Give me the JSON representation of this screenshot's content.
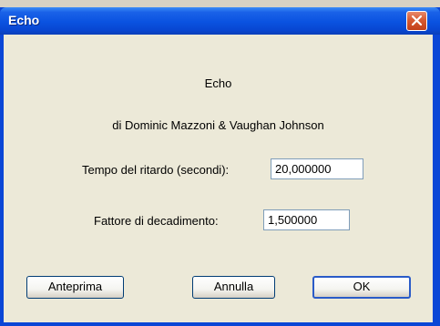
{
  "window": {
    "title": "Echo"
  },
  "header": {
    "plugin_name": "Echo",
    "authors": "di Dominic Mazzoni & Vaughan Johnson"
  },
  "fields": {
    "delay_label": "Tempo del ritardo (secondi):",
    "delay_value": "20,000000",
    "decay_label": "Fattore di decadimento:",
    "decay_value": "1,500000"
  },
  "buttons": {
    "preview": "Anteprima",
    "cancel": "Annulla",
    "ok": "OK"
  }
}
